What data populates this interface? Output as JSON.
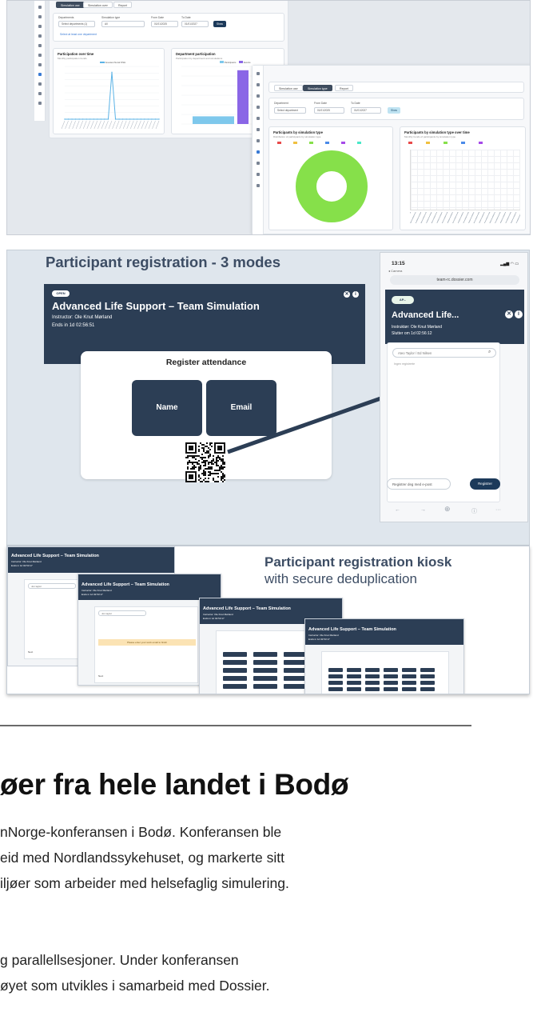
{
  "dashboard": {
    "tabs_left": [
      "Simulation use",
      "Simulation over",
      "Report"
    ],
    "filters_left": {
      "department_label": "Departments",
      "department_value": "Select departments (1)",
      "simtype_label": "Simulation type",
      "simtype_value": "All",
      "from_label": "From Date",
      "from_value": "01/01/2025",
      "to_label": "To Date",
      "to_value": "01/01/2027",
      "show_button": "Show",
      "link": "Select at least one department"
    },
    "chart_left_title": "Participation over time",
    "chart_left_sub": "Monthly participation trends",
    "chart_left_legend": "Anestesi Norsk NSH",
    "chart_mid_title": "Department participation",
    "chart_mid_sub": "Participation by department and simulations",
    "chart_mid_legend": [
      "Participants",
      "Events"
    ],
    "tabs_right": [
      "Simulation use",
      "Simulation type",
      "Report"
    ],
    "filters_right": {
      "department_label": "Department",
      "department_value": "Select department",
      "from_label": "From Date",
      "from_value": "01/01/2025",
      "to_label": "To Date",
      "to_value": "01/01/2027",
      "show_button": "Show"
    },
    "donut_title": "Participants by simulation type",
    "donut_sub": "Distribution of participants by simulation type",
    "lines_title": "Participants by simulation type over time",
    "lines_sub": "Monthly trends of participants by simulation type"
  },
  "chart_data": [
    {
      "type": "line",
      "title": "Participation over time",
      "series": [
        {
          "name": "Anestesi Norsk NSH",
          "values": [
            0,
            0,
            0,
            0,
            0,
            0,
            0,
            0,
            0,
            0,
            0,
            0,
            0,
            80,
            0,
            0,
            0,
            0,
            0,
            0,
            0,
            0,
            0,
            0,
            0,
            0,
            0
          ]
        }
      ],
      "color": "#5bb3e6",
      "ylim": [
        0,
        90
      ],
      "grid": true
    },
    {
      "type": "bar",
      "title": "Department participation",
      "series": [
        {
          "name": "Participants",
          "values": [
            10
          ],
          "color": "#7ec8ec"
        },
        {
          "name": "Events",
          "values": [
            70
          ],
          "color": "#8a66e6"
        }
      ],
      "ylim": [
        0,
        75
      ]
    },
    {
      "type": "pie",
      "title": "Participants by simulation type",
      "values": [
        100
      ],
      "colors": [
        "#86e04a"
      ],
      "donut": true
    },
    {
      "type": "line",
      "title": "Participants by simulation type over time",
      "series": [],
      "grid": true
    }
  ],
  "registration": {
    "heading": "Participant registration - 3 modes",
    "badge": "OPEN",
    "sim_title": "Advanced Life Support – Team Simulation",
    "instructor": "Instructor: Ole Knut Mørland",
    "ends": "Ends in 1d 02:56:51",
    "card_title": "Register attendance",
    "mode_name": "Name",
    "mode_email": "Email",
    "phone": {
      "time": "13:15",
      "camera": "◂ Camera",
      "url": "team-rc.dossier.com",
      "badge": "AP...",
      "title": "Advanced Life...",
      "instructor": "Instruktør: Ole Knut Mørland",
      "ends": "Slutter om 1d 02:56:12",
      "search_placeholder": "Ateo Taylor / Ed Nilsen",
      "empty": "Ingen registrerte",
      "email_placeholder": "Registrer deg med e-post",
      "register_button": "Registrer"
    }
  },
  "kiosk": {
    "title": "Participant registration kiosk",
    "subtitle": "with secure deduplication",
    "window_title": "Advanced Life Support – Team Simulation",
    "window_instructor": "Instructor: Ole Knut Mørland",
    "window_ends": "Ends in 1d 02:53:17",
    "search_placeholder": "Jon taylor",
    "next": "Next",
    "warning": "Please enter your work email to finish"
  },
  "article": {
    "headline": "øer fra hele landet i Bodø",
    "lines": [
      "nNorge-konferansen i Bodø. Konferansen ble",
      "eid med Nordlandssykehuset, og markerte sitt",
      "iljøer som arbeider med helsefaglig simulering.",
      "",
      "g parallellsesjoner. Under konferansen",
      "øyet som utvikles i samarbeid med Dossier."
    ]
  }
}
